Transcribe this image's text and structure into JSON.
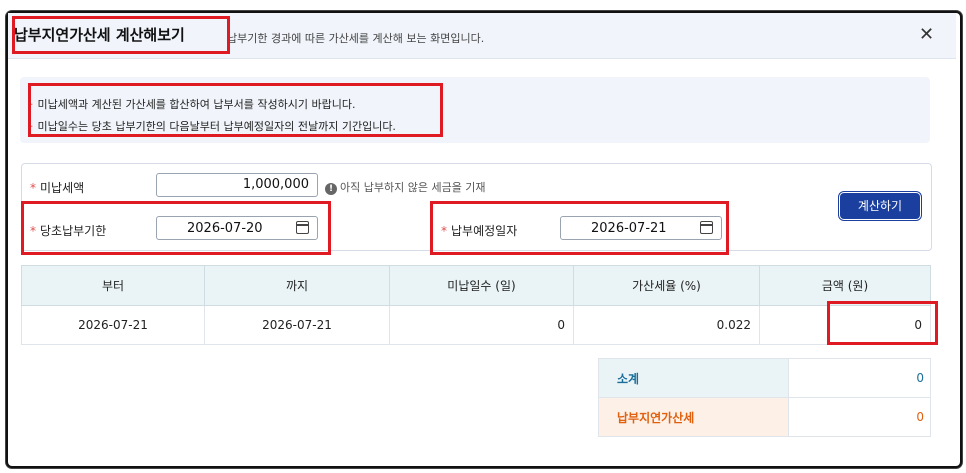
{
  "header": {
    "title": "납부지연가산세 계산해보기",
    "subtitle": "납부기한 경과에 따른 가산세를 계산해 보는 화면입니다.",
    "close_label": "✕"
  },
  "notices": [
    "미납세액과 계산된 가산세를 합산하여 납부서를 작성하시기 바랍니다.",
    "미납일수는 당초 납부기한의 다음날부터 납부예정일자의 전날까지 기간입니다."
  ],
  "form": {
    "unpaid_label": "미납세액",
    "unpaid_value": "1,000,000",
    "unpaid_hint": "아직 납부하지 않은 세금을 기재",
    "original_due_label": "당초납부기한",
    "original_due_value": "2026-07-20",
    "planned_pay_label": "납부예정일자",
    "planned_pay_value": "2026-07-21",
    "calc_button": "계산하기"
  },
  "result_table": {
    "headers": [
      "부터",
      "까지",
      "미납일수 (일)",
      "가산세율 (%)",
      "금액 (원)"
    ],
    "rows": [
      [
        "2026-07-21",
        "2026-07-21",
        "0",
        "0.022",
        "0"
      ]
    ]
  },
  "summary": {
    "subtotal_label": "소계",
    "subtotal_value": "0",
    "penalty_label": "납부지연가산세",
    "penalty_value": "0"
  },
  "colors": {
    "highlight": "#e01a22",
    "button": "#1a3f9f",
    "subtotal": "#1a6e9a",
    "penalty": "#e0600f"
  }
}
